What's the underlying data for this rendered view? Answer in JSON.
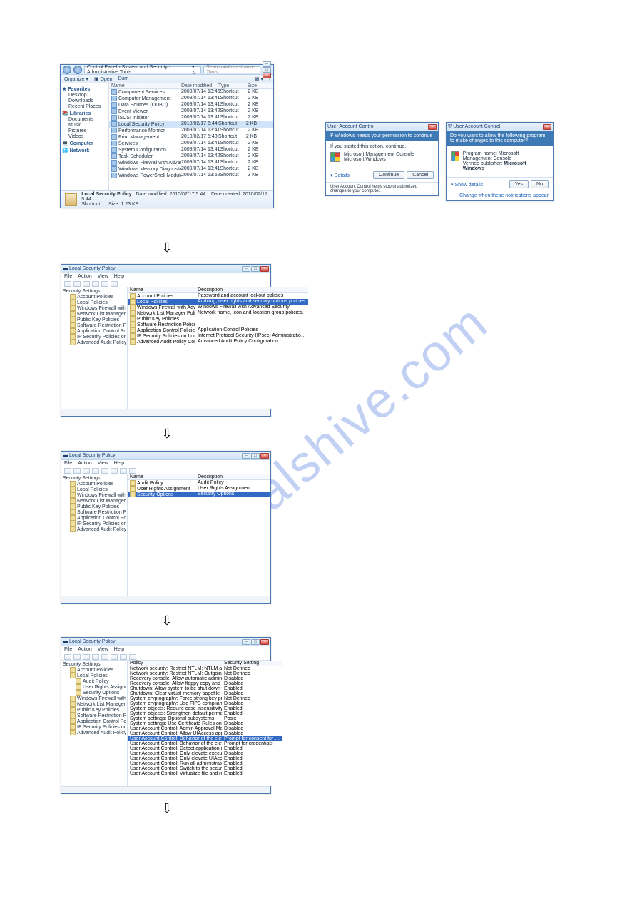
{
  "watermark": "manualshive.com",
  "explorer": {
    "breadcrumb": "Control Panel  ›  System and Security  ›  Administrative Tools",
    "search_placeholder": "Search Administrative Tools",
    "toolbar": {
      "organize": "Organize ▾",
      "open": "Open",
      "burn": "Burn"
    },
    "nav": {
      "favorites": "Favorites",
      "favorites_items": [
        "Desktop",
        "Downloads",
        "Recent Places"
      ],
      "libraries": "Libraries",
      "libraries_items": [
        "Documents",
        "Music",
        "Pictures",
        "Videos"
      ],
      "computer": "Computer",
      "network": "Network"
    },
    "columns": {
      "name": "Name",
      "date": "Date modified",
      "type": "Type",
      "size": "Size"
    },
    "rows": [
      {
        "name": "Component Services",
        "date": "2009/07/14 13:46",
        "type": "Shortcut",
        "size": "2 KB",
        "sel": false
      },
      {
        "name": "Computer Management",
        "date": "2009/07/14 13:41",
        "type": "Shortcut",
        "size": "2 KB",
        "sel": false
      },
      {
        "name": "Data Sources (ODBC)",
        "date": "2009/07/14 13:41",
        "type": "Shortcut",
        "size": "2 KB",
        "sel": false
      },
      {
        "name": "Event Viewer",
        "date": "2009/07/14 13:42",
        "type": "Shortcut",
        "size": "2 KB",
        "sel": false
      },
      {
        "name": "iSCSI Initiator",
        "date": "2009/07/14 13:41",
        "type": "Shortcut",
        "size": "2 KB",
        "sel": false
      },
      {
        "name": "Local Security Policy",
        "date": "2010/02/17 5:44",
        "type": "Shortcut",
        "size": "2 KB",
        "sel": true
      },
      {
        "name": "Performance Monitor",
        "date": "2009/07/14 13:41",
        "type": "Shortcut",
        "size": "2 KB",
        "sel": false
      },
      {
        "name": "Print Management",
        "date": "2010/02/17 5:43",
        "type": "Shortcut",
        "size": "2 KB",
        "sel": false
      },
      {
        "name": "Services",
        "date": "2009/07/14 13:41",
        "type": "Shortcut",
        "size": "2 KB",
        "sel": false
      },
      {
        "name": "System Configuration",
        "date": "2009/07/14 13:41",
        "type": "Shortcut",
        "size": "2 KB",
        "sel": false
      },
      {
        "name": "Task Scheduler",
        "date": "2009/07/14 13:42",
        "type": "Shortcut",
        "size": "2 KB",
        "sel": false
      },
      {
        "name": "Windows Firewall with Advanced Security",
        "date": "2009/07/14 13:41",
        "type": "Shortcut",
        "size": "2 KB",
        "sel": false
      },
      {
        "name": "Windows Memory Diagnostic",
        "date": "2009/07/14 13:41",
        "type": "Shortcut",
        "size": "2 KB",
        "sel": false
      },
      {
        "name": "Windows PowerShell Modules",
        "date": "2009/07/14 13:52",
        "type": "Shortcut",
        "size": "3 KB",
        "sel": false
      }
    ],
    "details": {
      "title": "Local Security Policy",
      "l1": "Date modified: 2010/02/17 5:44",
      "l2": "Date created: 2010/02/17 5:44",
      "l3": "Shortcut",
      "l4": "Size: 1.23 KB"
    }
  },
  "uac1": {
    "title": "User Account Control",
    "header": "Windows needs your permission to continue",
    "sub": "If you started this action, continue.",
    "program": "Microsoft Management Console",
    "publisher": "Microsoft Windows",
    "details": "Details",
    "continue": "Continue",
    "cancel": "Cancel",
    "footer": "User Account Control helps stop unauthorized changes to your computer."
  },
  "uac2": {
    "title": "User Account Control",
    "header": "Do you want to allow the following program to make changes to this computer?",
    "program_label": "Program name:",
    "program": "Microsoft Management Console",
    "publisher_label": "Verified publisher:",
    "publisher": "Microsoft Windows",
    "show": "Show details",
    "yes": "Yes",
    "no": "No",
    "link": "Change when these notifications appear"
  },
  "mmc1": {
    "title": "Local Security Policy",
    "menu": [
      "File",
      "Action",
      "View",
      "Help"
    ],
    "tree": [
      "Security Settings",
      "Account Policies",
      "Local Policies",
      "Windows Firewall with Advanced Sec…",
      "Network List Manager Policies",
      "Public Key Policies",
      "Software Restriction Policies",
      "Application Control Policies",
      "IP Security Policies on Local Compu…",
      "Advanced Audit Policy Configuration"
    ],
    "columns": {
      "name": "Name",
      "desc": "Description"
    },
    "rows": [
      {
        "n": "Account Policies",
        "d": "Password and account lockout policies",
        "sel": false
      },
      {
        "n": "Local Policies",
        "d": "Auditing, user rights and security options policies",
        "sel": true
      },
      {
        "n": "Windows Firewall with Advanced Security",
        "d": "Windows Firewall with Advanced Security",
        "sel": false
      },
      {
        "n": "Network List Manager Policies",
        "d": "Network name, icon and location group policies.",
        "sel": false
      },
      {
        "n": "Public Key Policies",
        "d": "",
        "sel": false
      },
      {
        "n": "Software Restriction Policies",
        "d": "",
        "sel": false
      },
      {
        "n": "Application Control Policies",
        "d": "Application Control Policies",
        "sel": false
      },
      {
        "n": "IP Security Policies on Local Computer",
        "d": "Internet Protocol Security (IPsec) Administratio…",
        "sel": false
      },
      {
        "n": "Advanced Audit Policy Configuration",
        "d": "Advanced Audit Policy Configuration",
        "sel": false
      }
    ]
  },
  "mmc2": {
    "title": "Local Security Policy",
    "menu": [
      "File",
      "Action",
      "View",
      "Help"
    ],
    "tree": [
      "Security Settings",
      "Account Policies",
      "Local Policies",
      "Windows Firewall with Advanced Sec…",
      "Network List Manager Policies",
      "Public Key Policies",
      "Software Restriction Policies",
      "Application Control Policies",
      "IP Security Policies on Local Compu…",
      "Advanced Audit Policy Configuration"
    ],
    "columns": {
      "name": "Name",
      "desc": "Description"
    },
    "rows": [
      {
        "n": "Audit Policy",
        "d": "Audit Policy",
        "sel": false
      },
      {
        "n": "User Rights Assignment",
        "d": "User Rights Assignment",
        "sel": false
      },
      {
        "n": "Security Options",
        "d": "Security Options",
        "sel": true
      }
    ]
  },
  "mmc3": {
    "title": "Local Security Policy",
    "menu": [
      "File",
      "Action",
      "View",
      "Help"
    ],
    "tree_root": "Security Settings",
    "tree": [
      {
        "t": "Account Policies",
        "l": 1
      },
      {
        "t": "Local Policies",
        "l": 1
      },
      {
        "t": "Audit Policy",
        "l": 2
      },
      {
        "t": "User Rights Assignment",
        "l": 2
      },
      {
        "t": "Security Options",
        "l": 2
      },
      {
        "t": "Windows Firewall with Advanced Sec…",
        "l": 1
      },
      {
        "t": "Network List Manager Policies",
        "l": 1
      },
      {
        "t": "Public Key Policies",
        "l": 1
      },
      {
        "t": "Software Restriction Policies",
        "l": 1
      },
      {
        "t": "Application Control Policies",
        "l": 1
      },
      {
        "t": "IP Security Policies on Local Compu…",
        "l": 1
      },
      {
        "t": "Advanced Audit Policy Configuration",
        "l": 1
      }
    ],
    "columns": {
      "policy": "Policy",
      "setting": "Security Setting"
    },
    "rows": [
      {
        "p": "Network security: Restrict NTLM: NTLM authentication in th…",
        "s": "Not Defined",
        "sel": false
      },
      {
        "p": "Network security: Restrict NTLM: Outgoing NTLM m…",
        "s": "Not Defined",
        "sel": false
      },
      {
        "p": "Recovery console: Allow automatic administrative logon",
        "s": "Disabled",
        "sel": false
      },
      {
        "p": "Recovery console: Allow floppy copy and access to all driv…",
        "s": "Disabled",
        "sel": false
      },
      {
        "p": "Shutdown: Allow system to be shut down without having to…",
        "s": "Enabled",
        "sel": false
      },
      {
        "p": "Shutdown: Clear virtual memory pagefile",
        "s": "Disabled",
        "sel": false
      },
      {
        "p": "System cryptography: Force strong key protection for user k…",
        "s": "Not Defined",
        "sel": false
      },
      {
        "p": "System cryptography: Use FIPS compliant algorithms for en…",
        "s": "Disabled",
        "sel": false
      },
      {
        "p": "System objects: Require case insensitivity for non-Windows …",
        "s": "Enabled",
        "sel": false
      },
      {
        "p": "System objects: Strengthen default permissions of internal s…",
        "s": "Enabled",
        "sel": false
      },
      {
        "p": "System settings: Optional subsystems",
        "s": "Posix",
        "sel": false
      },
      {
        "p": "System settings: Use Certificate Rules on Windows Executabl…",
        "s": "Disabled",
        "sel": false
      },
      {
        "p": "User Account Control: Admin Approval Mode for the Built-…",
        "s": "Disabled",
        "sel": false
      },
      {
        "p": "User Account Control: Allow UIAccess applications to prom…",
        "s": "Disabled",
        "sel": false
      },
      {
        "p": "User Account Control: Behavior of the elevation prompt for …",
        "s": "Prompt for consent for …",
        "sel": true
      },
      {
        "p": "User Account Control: Behavior of the elevation prompt for …",
        "s": "Prompt for credentials",
        "sel": false
      },
      {
        "p": "User Account Control: Detect application installations and p…",
        "s": "Enabled",
        "sel": false
      },
      {
        "p": "User Account Control: Only elevate executables that are sign…",
        "s": "Disabled",
        "sel": false
      },
      {
        "p": "User Account Control: Only elevate UIAccess applications th…",
        "s": "Enabled",
        "sel": false
      },
      {
        "p": "User Account Control: Run all administrators in Admin Appr…",
        "s": "Enabled",
        "sel": false
      },
      {
        "p": "User Account Control: Switch to the secure desktop when p…",
        "s": "Enabled",
        "sel": false
      },
      {
        "p": "User Account Control: Virtualize file and registry write failur…",
        "s": "Enabled",
        "sel": false
      }
    ]
  },
  "arrow": "⇩"
}
